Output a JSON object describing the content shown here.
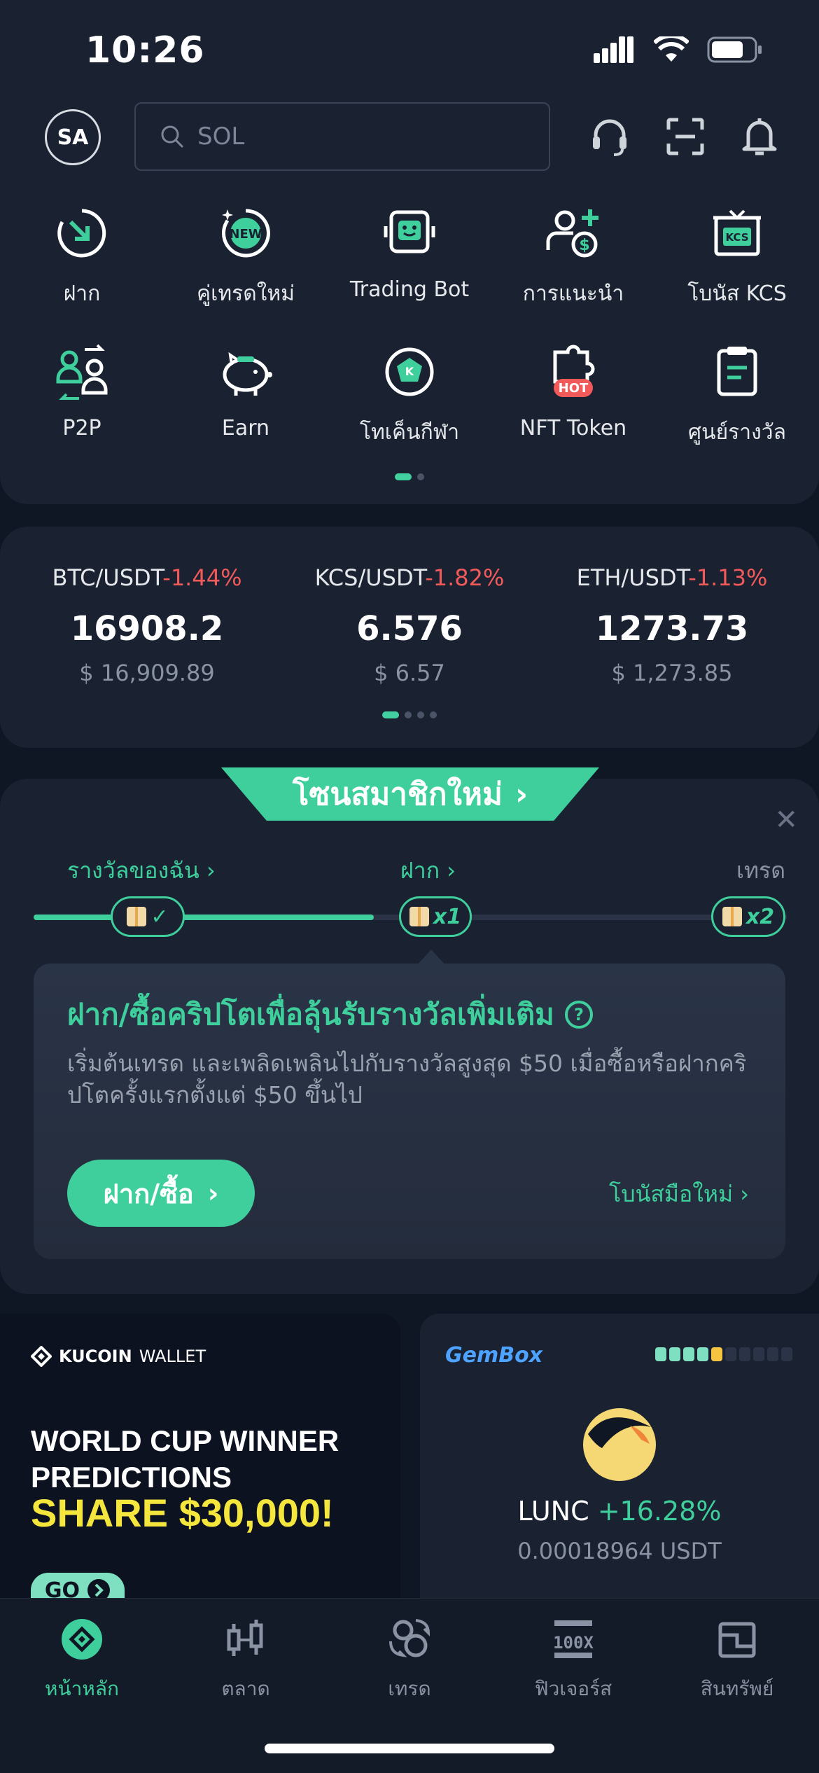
{
  "status_bar": {
    "time": "10:26"
  },
  "header": {
    "avatar_initials": "SA",
    "search_placeholder": "SOL"
  },
  "shortcuts": [
    {
      "label": "ฝาก",
      "icon": "deposit-icon"
    },
    {
      "label": "คู่เทรดใหม่",
      "icon": "new-pairs-icon"
    },
    {
      "label": "Trading Bot",
      "icon": "trading-bot-icon"
    },
    {
      "label": "การแนะนำ",
      "icon": "referral-icon"
    },
    {
      "label": "โบนัส KCS",
      "icon": "kcs-bonus-icon"
    },
    {
      "label": "P2P",
      "icon": "p2p-icon"
    },
    {
      "label": "Earn",
      "icon": "piggy-bank-icon"
    },
    {
      "label": "โทเค็นกีฬา",
      "icon": "soccer-ball-icon"
    },
    {
      "label": "NFT Token",
      "icon": "nft-hot-icon"
    },
    {
      "label": "ศูนย์รางวัล",
      "icon": "rewards-center-icon"
    }
  ],
  "tickers": [
    {
      "pair": "BTC/USDT",
      "change": "-1.44%",
      "price": "16908.2",
      "usd": "$ 16,909.89"
    },
    {
      "pair": "KCS/USDT",
      "change": "-1.82%",
      "price": "6.576",
      "usd": "$ 6.57"
    },
    {
      "pair": "ETH/USDT",
      "change": "-1.13%",
      "price": "1273.73",
      "usd": "$ 1,273.85"
    }
  ],
  "new_member": {
    "tab_title": "โซนสมาชิกใหม่",
    "steps": {
      "my_rewards": "รางวัลของฉัน",
      "deposit": "ฝาก",
      "trade": "เทรด"
    },
    "nodes": {
      "deposit_multiplier": "x1",
      "trade_multiplier": "x2"
    },
    "task_title": "ฝาก/ซื้อคริปโตเพื่อลุ้นรับรางวัลเพิ่มเติม",
    "task_desc": "เริ่มต้นเทรด และเพลิดเพลินไปกับรางวัลสูงสุด $50 เมื่อซื้อหรือฝากคริปโตครั้งแรกตั้งแต่ $50 ขึ้นไป",
    "deposit_button": "ฝาก/ซื้อ",
    "bonus_link": "โบนัสมือใหม่"
  },
  "promo_wallet": {
    "brand": "KUCOIN",
    "brand_suffix": "WALLET",
    "line1": "WORLD CUP WINNER",
    "line2": "PREDICTIONS",
    "line3": "SHARE $30,000!",
    "go": "GO"
  },
  "gembox": {
    "title": "GemBox",
    "coin": "LUNC",
    "change": "+16.28%",
    "price": "0.00018964 USDT"
  },
  "bottom_nav": [
    {
      "label": "หน้าหลัก",
      "icon": "home-kucoin-icon",
      "active": true
    },
    {
      "label": "ตลาด",
      "icon": "market-candles-icon"
    },
    {
      "label": "เทรด",
      "icon": "trade-swap-icon"
    },
    {
      "label": "ฟิวเจอร์ส",
      "icon": "futures-100x-icon"
    },
    {
      "label": "สินทรัพย์",
      "icon": "wallet-assets-icon"
    }
  ],
  "colors": {
    "accent": "#3ecf9c",
    "negative": "#f25a5a",
    "bg": "#0f1624",
    "card": "#1a2232",
    "promo_yellow": "#f5e63e"
  }
}
